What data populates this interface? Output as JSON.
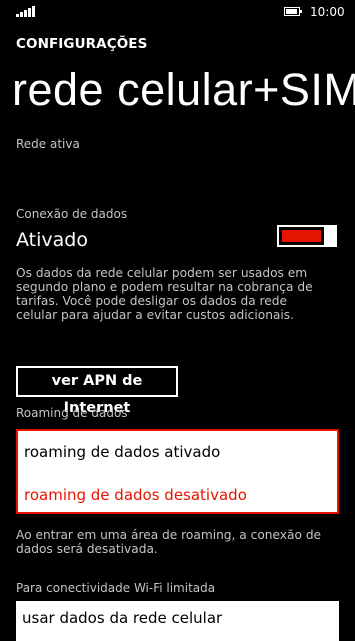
{
  "status_bar": {
    "signal_icon": "signal-strength-icon",
    "battery_icon": "battery-icon",
    "time": "10:00"
  },
  "header": {
    "app_title": "CONFIGURAÇÕES",
    "page_title": "rede celular+SIM"
  },
  "active_network": {
    "label": "Rede ativa"
  },
  "data_connection": {
    "label": "Conexão de dados",
    "state": "Ativado",
    "toggle_on": true,
    "toggle_color": "#e51400",
    "description": "Os dados da rede celular podem ser usados em segundo plano e podem resultar na cobrança de tarifas. Você pode desligar os dados da rede celular para ajudar a evitar custos adicionais."
  },
  "apn_button": {
    "label": "ver APN de Internet"
  },
  "roaming": {
    "label": "Roaming de dados",
    "options": [
      "roaming de dados ativado",
      "roaming de dados desativado"
    ],
    "selected_index": 1,
    "accent_color": "#e51400",
    "note": "Ao entrar em uma área de roaming, a conexão de dados será desativada."
  },
  "wifi_limited": {
    "label": "Para conectividade Wi-Fi limitada",
    "value": "usar dados da rede celular"
  }
}
